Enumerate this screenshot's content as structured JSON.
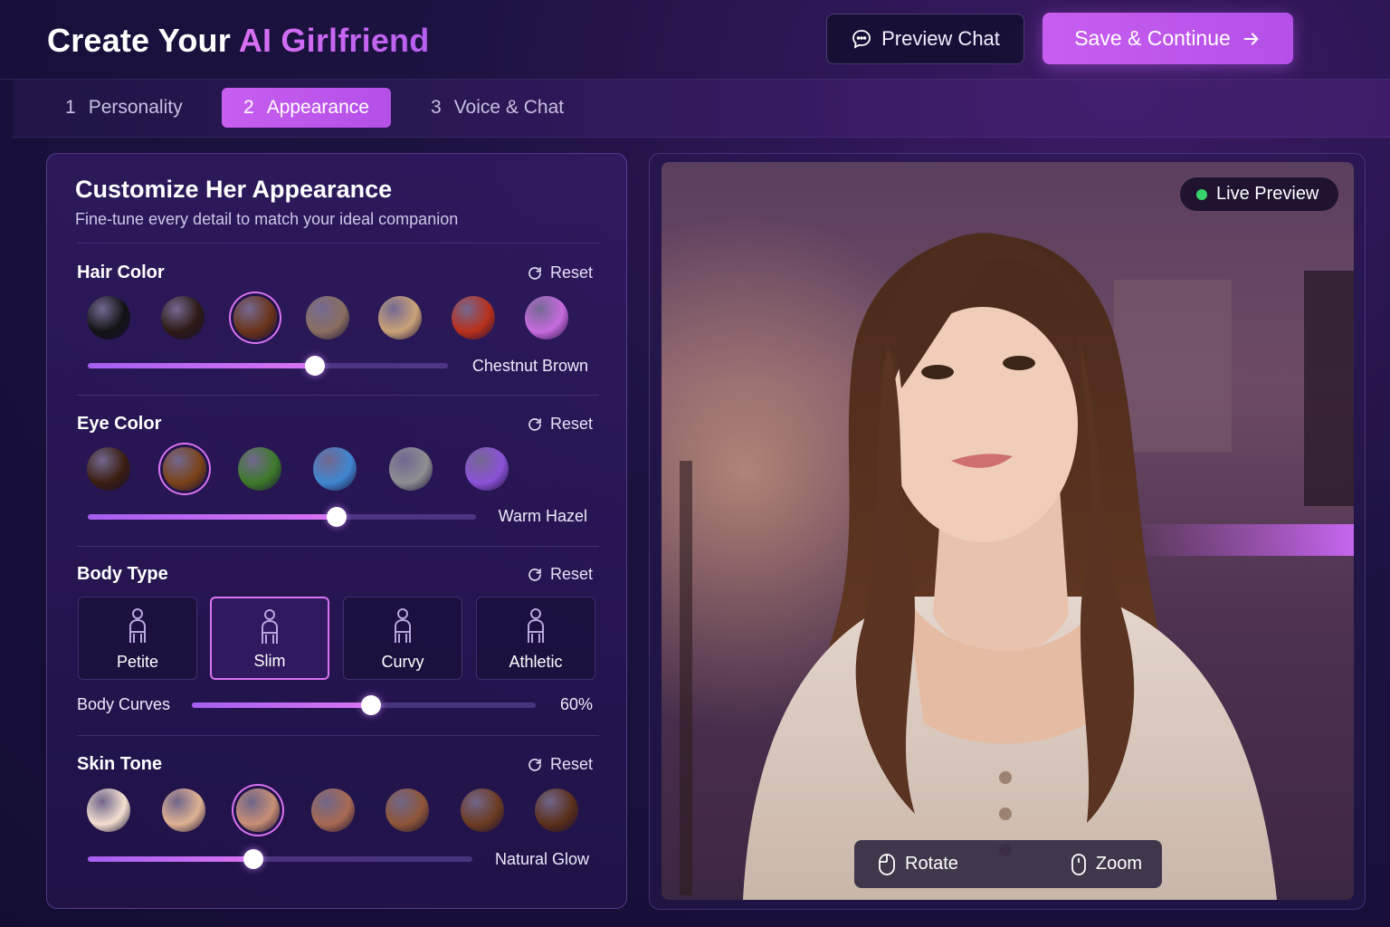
{
  "header": {
    "title_main": "Create Your ",
    "title_accent": "AI Girlfriend",
    "preview_chat_label": "Preview Chat",
    "save_label": "Save & Continue"
  },
  "tabs": [
    {
      "num": "1",
      "label": "Personality",
      "active": false
    },
    {
      "num": "2",
      "label": "Appearance",
      "active": true
    },
    {
      "num": "3",
      "label": "Voice & Chat",
      "active": false
    }
  ],
  "panel": {
    "title": "Customize Her Appearance",
    "subtitle": "Fine-tune every detail to match your ideal companion",
    "reset_label": "Reset",
    "hair": {
      "label": "Hair Color",
      "value_label": "Chestnut Brown",
      "slider": 0.63,
      "swatches": [
        "#121214",
        "#2c1a14",
        "#6a3419",
        "#8a6f60",
        "#caa277",
        "#b9301b",
        "#c76be0"
      ],
      "selected": 2
    },
    "eyes": {
      "label": "Eye Color",
      "value_label": "Warm Hazel",
      "slider": 0.64,
      "swatches": [
        "#3a1e10",
        "#7a4318",
        "#3d7a2a",
        "#3f86d0",
        "#8e8e92",
        "#8b52d8"
      ],
      "selected": 1
    },
    "body": {
      "label": "Body Type",
      "types": [
        "Petite",
        "Slim",
        "Curvy",
        "Athletic"
      ],
      "selected": 1,
      "curves_label": "Body Curves",
      "curves_value": "60%",
      "curves_slider": 0.52
    },
    "skin": {
      "label": "Skin Tone",
      "value_label": "Natural Glow",
      "slider": 0.43,
      "swatches": [
        "#f4dfd0",
        "#e0b293",
        "#c88f75",
        "#a86a52",
        "#8e5638",
        "#6d3b22",
        "#5b2f1a"
      ],
      "selected": 2
    }
  },
  "preview": {
    "live_label": "Live Preview",
    "rotate_label": "Rotate",
    "zoom_label": "Zoom"
  },
  "colors": {
    "accent": "#c85ef0",
    "live_dot": "#38d36b"
  }
}
